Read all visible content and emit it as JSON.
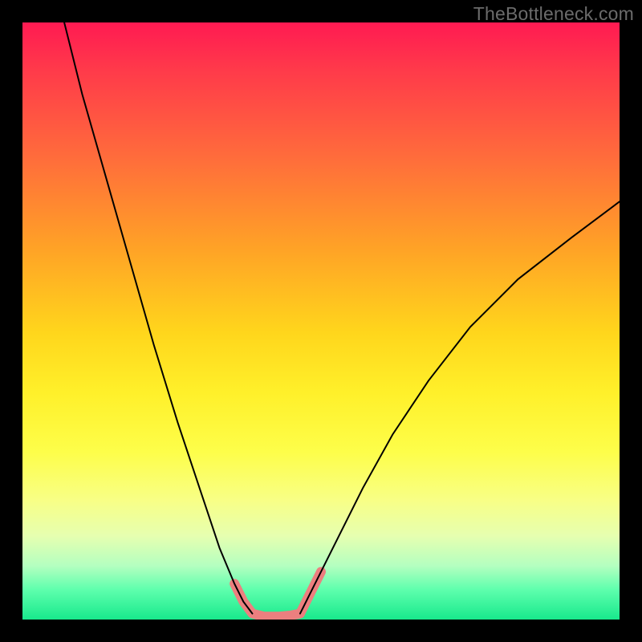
{
  "watermark": "TheBottleneck.com",
  "chart_data": {
    "type": "line",
    "title": "",
    "xlabel": "",
    "ylabel": "",
    "xlim": [
      0,
      100
    ],
    "ylim": [
      0,
      100
    ],
    "grid": false,
    "legend": false,
    "series": [
      {
        "name": "left-curve",
        "x": [
          7,
          10,
          14,
          18,
          22,
          26,
          30,
          33,
          35.5,
          37,
          38.5
        ],
        "y": [
          100,
          88,
          74,
          60,
          46,
          33,
          21,
          12,
          6,
          3,
          1
        ],
        "color": "#000000",
        "width": 2
      },
      {
        "name": "right-curve",
        "x": [
          46.5,
          48,
          50,
          53,
          57,
          62,
          68,
          75,
          83,
          92,
          100
        ],
        "y": [
          1,
          4,
          8,
          14,
          22,
          31,
          40,
          49,
          57,
          64,
          70
        ],
        "color": "#000000",
        "width": 2
      },
      {
        "name": "highlight-segment",
        "x": [
          35.5,
          37,
          38.5,
          40.5,
          43,
          45,
          46.5,
          48,
          50
        ],
        "y": [
          6,
          3,
          1,
          0.5,
          0.5,
          0.7,
          1,
          4,
          8
        ],
        "color": "#ec7f7f",
        "width": 12
      }
    ],
    "annotations": []
  }
}
